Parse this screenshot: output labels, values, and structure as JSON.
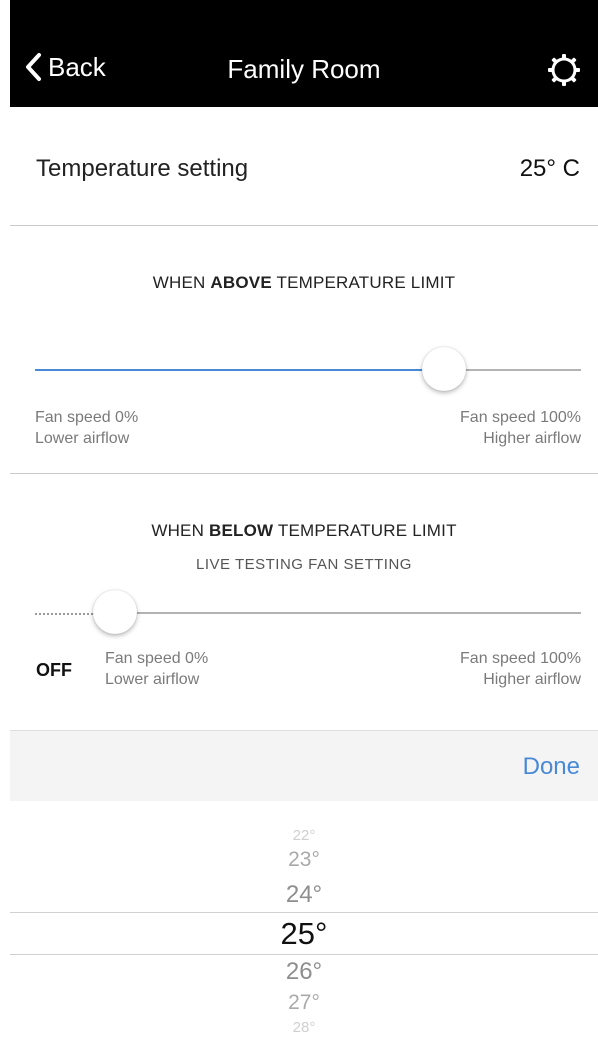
{
  "header": {
    "back_label": "Back",
    "title": "Family Room",
    "back_icon": "chevron-left-icon",
    "settings_icon": "gear-icon"
  },
  "temperature": {
    "label": "Temperature setting",
    "value": "25° C"
  },
  "above": {
    "title_prefix": "WHEN ",
    "title_bold": "ABOVE",
    "title_suffix": " TEMPERATURE LIMIT",
    "slider_value_fraction": 0.77,
    "min_line1": "Fan speed 0%",
    "min_line2": "Lower airflow",
    "max_line1": "Fan speed 100%",
    "max_line2": "Higher airflow"
  },
  "below": {
    "title_prefix": "WHEN ",
    "title_bold": "BELOW",
    "title_suffix": " TEMPERATURE LIMIT",
    "subtitle": "LIVE TESTING FAN SETTING",
    "slider_value_fraction": 0.0,
    "off_label": "OFF",
    "min_line1": "Fan speed 0%",
    "min_line2": "Lower airflow",
    "max_line1": "Fan speed 100%",
    "max_line2": "Higher airflow"
  },
  "toolbar": {
    "done_label": "Done"
  },
  "picker": {
    "options": [
      "22°",
      "23°",
      "24°",
      "25°",
      "26°",
      "27°",
      "28°"
    ],
    "selected": "25°"
  },
  "colors": {
    "accent": "#4a8ad4",
    "navbar": "#000000",
    "toolbar": "#f4f4f5"
  }
}
